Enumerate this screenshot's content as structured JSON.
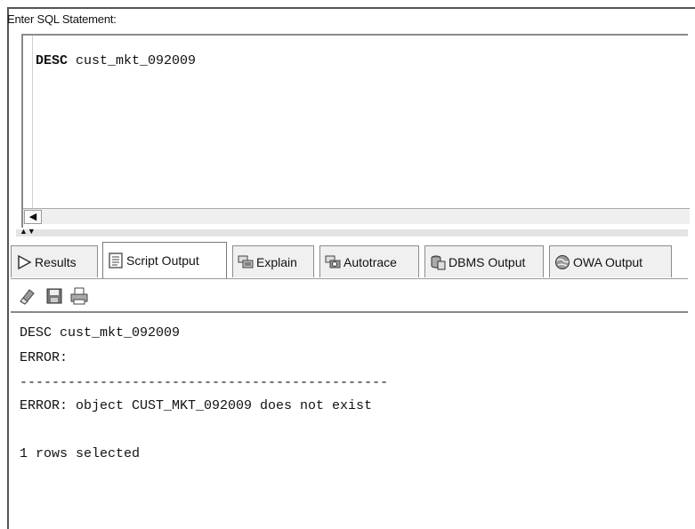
{
  "editor": {
    "label": "Enter SQL Statement:",
    "keyword": "DESC",
    "argument": " cust_mkt_092009"
  },
  "tabs": [
    {
      "label": "Results",
      "icon": "results-arrow-icon"
    },
    {
      "label": "Script Output",
      "icon": "script-output-icon"
    },
    {
      "label": "Explain",
      "icon": "explain-icon"
    },
    {
      "label": "Autotrace",
      "icon": "autotrace-icon"
    },
    {
      "label": "DBMS Output",
      "icon": "dbms-output-icon"
    },
    {
      "label": "OWA Output",
      "icon": "owa-output-icon"
    }
  ],
  "toolbar": {
    "icons": [
      "eraser-icon",
      "save-icon",
      "print-icon"
    ]
  },
  "output": {
    "lines": [
      "DESC cust_mkt_092009",
      "ERROR:",
      "----------------------------------------------",
      "ERROR: object CUST_MKT_092009 does not exist",
      "",
      "1 rows selected"
    ]
  },
  "colors": {
    "border": "#555555",
    "tab_bg": "#f0f0f0",
    "active_tab_bg": "#ffffff"
  }
}
